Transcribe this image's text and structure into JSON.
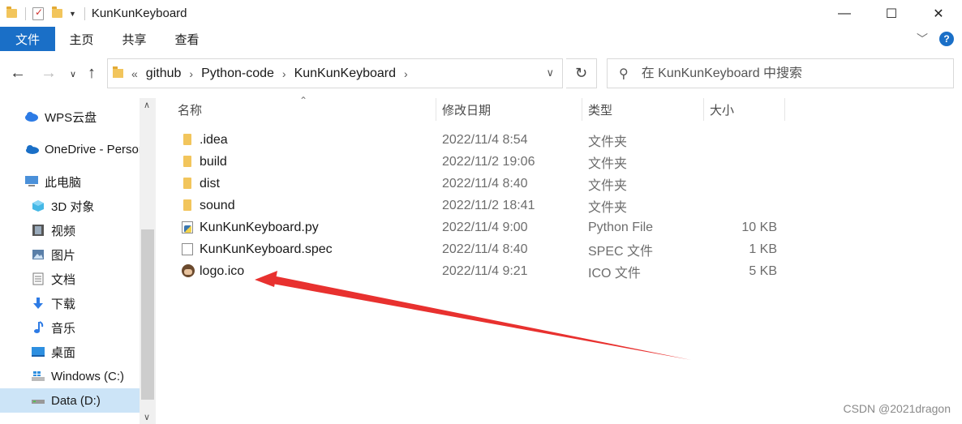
{
  "window": {
    "title": "KunKunKeyboard",
    "controls": {
      "minimize": "—",
      "maximize": "☐",
      "close": "✕"
    }
  },
  "ribbon": {
    "tabs": [
      "文件",
      "主页",
      "共享",
      "查看"
    ],
    "help": "?"
  },
  "address": {
    "overflow": "«",
    "crumbs": [
      "github",
      "Python-code",
      "KunKunKeyboard"
    ],
    "separator": "›"
  },
  "search": {
    "placeholder": "在 KunKunKeyboard 中搜索"
  },
  "sidebar": {
    "items": [
      {
        "label": "WPS云盘",
        "icon": "cloud-icon",
        "color": "#2d7be5"
      },
      {
        "label": "OneDrive - Personal",
        "icon": "onedrive-icon",
        "color": "#1a6fc7"
      },
      {
        "label": "此电脑",
        "icon": "computer-icon",
        "color": "#4a90d9"
      },
      {
        "label": "3D 对象",
        "icon": "3d-objects-icon",
        "color": "#45b8e6"
      },
      {
        "label": "视频",
        "icon": "video-icon",
        "color": "#555555"
      },
      {
        "label": "图片",
        "icon": "pictures-icon",
        "color": "#5a7fa8"
      },
      {
        "label": "文档",
        "icon": "documents-icon",
        "color": "#7a7a7a"
      },
      {
        "label": "下载",
        "icon": "download-icon",
        "color": "#2d7be5"
      },
      {
        "label": "音乐",
        "icon": "music-icon",
        "color": "#2d7be5"
      },
      {
        "label": "桌面",
        "icon": "desktop-icon",
        "color": "#2d8fe0"
      },
      {
        "label": "Windows (C:)",
        "icon": "windows-drive-icon",
        "color": "#2d8fe0"
      },
      {
        "label": "Data (D:)",
        "icon": "drive-icon",
        "color": "#666666",
        "selected": true
      }
    ]
  },
  "columns": {
    "name": "名称",
    "modified": "修改日期",
    "type": "类型",
    "size": "大小"
  },
  "files": [
    {
      "name": ".idea",
      "modified": "2022/11/4 8:54",
      "type": "文件夹",
      "size": "",
      "icon": "folder-icon"
    },
    {
      "name": "build",
      "modified": "2022/11/2 19:06",
      "type": "文件夹",
      "size": "",
      "icon": "folder-icon"
    },
    {
      "name": "dist",
      "modified": "2022/11/4 8:40",
      "type": "文件夹",
      "size": "",
      "icon": "folder-icon"
    },
    {
      "name": "sound",
      "modified": "2022/11/2 18:41",
      "type": "文件夹",
      "size": "",
      "icon": "folder-icon"
    },
    {
      "name": "KunKunKeyboard.py",
      "modified": "2022/11/4 9:00",
      "type": "Python File",
      "size": "10 KB",
      "icon": "python-file-icon"
    },
    {
      "name": "KunKunKeyboard.spec",
      "modified": "2022/11/4 8:40",
      "type": "SPEC 文件",
      "size": "1 KB",
      "icon": "file-icon"
    },
    {
      "name": "logo.ico",
      "modified": "2022/11/4 9:21",
      "type": "ICO 文件",
      "size": "5 KB",
      "icon": "ico-file-icon"
    }
  ],
  "annotation": {
    "color": "#e8312f"
  },
  "watermark": "CSDN @2021dragon"
}
